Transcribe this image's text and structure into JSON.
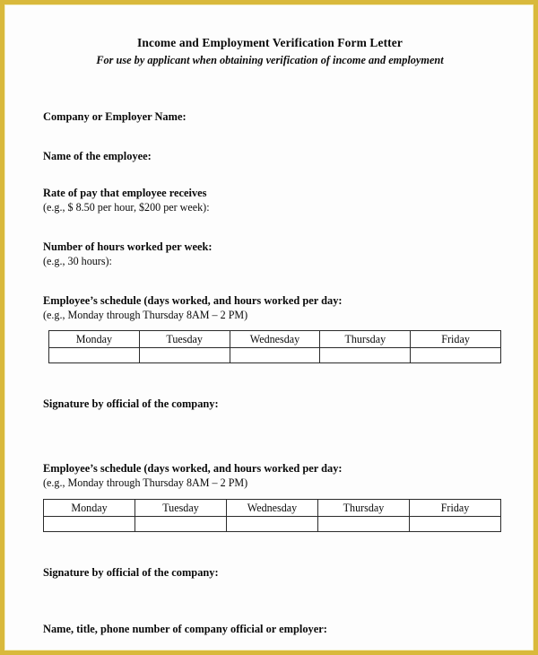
{
  "document": {
    "title": "Income and Employment Verification Form Letter",
    "subtitle": "For use by applicant when obtaining verification of income and employment",
    "fields": {
      "company_label": "Company or Employer Name:",
      "employee_name_label": "Name of the employee:",
      "rate_of_pay_label": "Rate of pay that employee receives",
      "rate_of_pay_example": "(e.g., $ 8.50 per hour, $200 per week):",
      "hours_per_week_label": "Number of hours worked per week:",
      "hours_per_week_example": "(e.g., 30 hours):",
      "schedule_label": "Employee’s schedule (days worked, and hours worked per day:",
      "schedule_example": "(e.g., Monday through Thursday 8AM – 2 PM)",
      "signature_label": "Signature by official of the company:",
      "name_title_phone_label": "Name, title, phone number of company official or employer:"
    },
    "schedule_table": {
      "headers": [
        "Monday",
        "Tuesday",
        "Wednesday",
        "Thursday",
        "Friday"
      ],
      "rows": [
        [
          "",
          "",
          "",
          "",
          ""
        ]
      ]
    },
    "colors": {
      "frame": "#d9b93c",
      "page": "#fdfdfd",
      "text": "#0a0a0a",
      "table_border": "#2b2b2b"
    }
  }
}
